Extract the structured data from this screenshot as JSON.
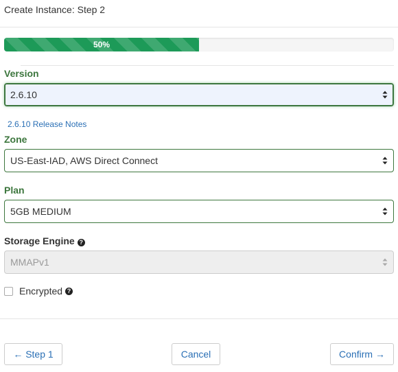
{
  "header": {
    "title": "Create Instance: Step 2"
  },
  "progress": {
    "label": "50%",
    "value": 0.5,
    "color": "#1d9a58"
  },
  "version": {
    "label": "Version",
    "selected": "2.6.10",
    "release_notes_link": "2.6.10 Release Notes"
  },
  "zone": {
    "label": "Zone",
    "selected": "US-East-IAD, AWS Direct Connect"
  },
  "plan": {
    "label": "Plan",
    "selected": "5GB MEDIUM"
  },
  "storage_engine": {
    "label": "Storage Engine",
    "selected": "MMAPv1",
    "help_icon": "question-circle-icon"
  },
  "encrypted": {
    "label": "Encrypted",
    "checked": false,
    "help_icon": "question-circle-icon"
  },
  "buttons": {
    "back": "← Step 1",
    "cancel": "Cancel",
    "confirm": "Confirm →"
  },
  "colors": {
    "label_valid": "#3c763d",
    "link": "#2a6fb5",
    "select_focus_bg": "#eef3fd"
  }
}
